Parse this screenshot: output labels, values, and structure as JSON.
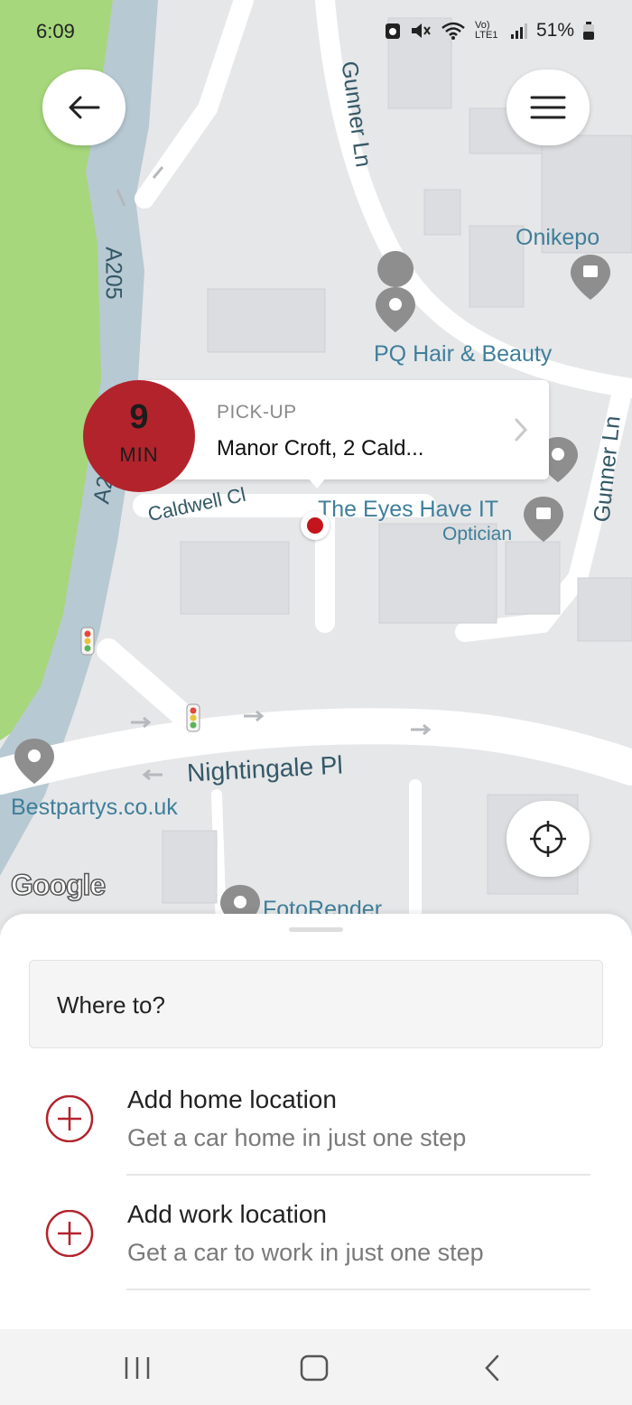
{
  "status_bar": {
    "time": "6:09",
    "signal_text": "Vo) LTE1",
    "battery_percent": "51%"
  },
  "map": {
    "labels": {
      "gunner_ln_top": "Gunner Ln",
      "a205": "A205",
      "onikepo": "Onikepo",
      "pq_hair": "PQ Hair & Beauty",
      "gunner_ln_right": "Gunner Ln",
      "caldwell": "Caldwell Cl",
      "eyes_have_it": "The Eyes Have IT",
      "optician": "Optician",
      "nightingale": "Nightingale Pl",
      "bestpartys": "Bestpartys.co.uk",
      "fotorender": "FotoRender",
      "google": "Google",
      "a_partial": "A2"
    },
    "accent_color": "#b3232c"
  },
  "eta": {
    "value": "9",
    "unit": "MIN"
  },
  "pickup": {
    "label": "PICK-UP",
    "address": "Manor Croft, 2 Cald..."
  },
  "sheet": {
    "search_placeholder": "Where to?",
    "locations": [
      {
        "title": "Add home location",
        "subtitle": "Get a car home in just one step"
      },
      {
        "title": "Add work location",
        "subtitle": "Get a car to work in just one step"
      }
    ]
  },
  "icons": [
    "back-arrow-icon",
    "menu-icon",
    "locate-me-icon",
    "add-circle-icon",
    "recents-icon",
    "home-icon",
    "back-icon"
  ]
}
